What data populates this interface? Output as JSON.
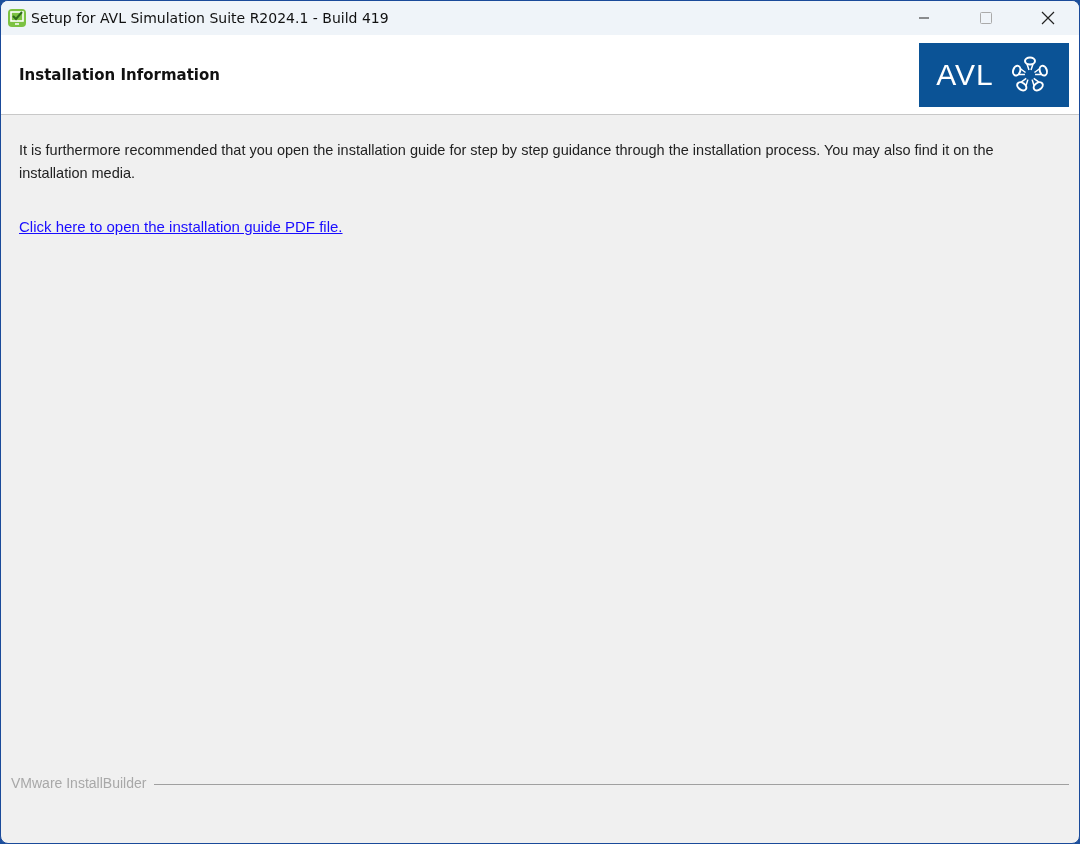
{
  "window": {
    "title": "Setup for AVL Simulation Suite R2024.1 - Build 419"
  },
  "header": {
    "title": "Installation Information",
    "logo_text": "AVL"
  },
  "body": {
    "paragraph": "It is furthermore recommended that you open the installation guide for step by step guidance through the installation process. You may also find it on the installation media.",
    "link": "Click here to open the installation guide PDF file."
  },
  "footer": {
    "brand": "VMware InstallBuilder"
  }
}
